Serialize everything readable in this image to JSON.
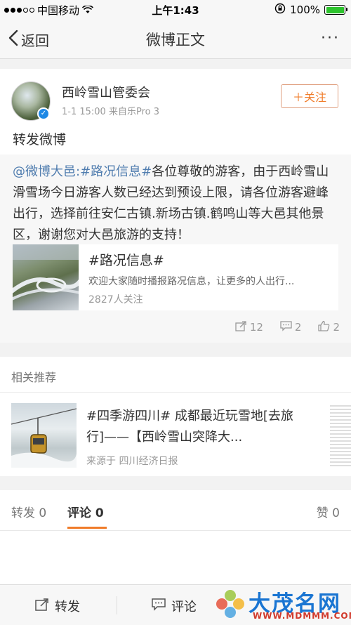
{
  "status_bar": {
    "carrier": "中国移动",
    "time": "上午1:43",
    "battery": "100%"
  },
  "nav": {
    "back_label": "返回",
    "title": "微博正文",
    "more_label": "···"
  },
  "post": {
    "author": "西岭雪山管委会",
    "meta": "1-1 15:00  来自乐Pro 3",
    "follow_label": "＋关注",
    "text": "转发微博",
    "quoted": {
      "mention": "@微博大邑:",
      "hashtag": "#路况信息#",
      "body": "各位尊敬的游客，由于西岭雪山滑雪场今日游客人数已经达到预设上限，请各位游客避峰出行，选择前往安仁古镇.新场古镇.鹤鸣山等大邑其他景区，谢谢您对大邑旅游的支持！",
      "topic_card": {
        "title": "#路况信息#",
        "desc": "欢迎大家随时播报路况信息，让更多的人出行...",
        "followers": "2827人关注"
      },
      "repost_count": "12",
      "comment_count": "2",
      "like_count": "2"
    }
  },
  "related": {
    "header": "相关推荐",
    "item": {
      "title": "#四季游四川# 成都最近玩雪地[去旅行]——【西岭雪山突降大...",
      "source": "来源于 四川经济日报"
    }
  },
  "tabs": {
    "repost": "转发",
    "repost_count": "0",
    "comment": "评论",
    "comment_count": "0",
    "like": "赞",
    "like_count": "0"
  },
  "toolbar": {
    "repost_label": "转发",
    "comment_label": "评论"
  },
  "watermark": {
    "main": "大茂名网",
    "sub": "WWW.MDMMM.COM"
  }
}
